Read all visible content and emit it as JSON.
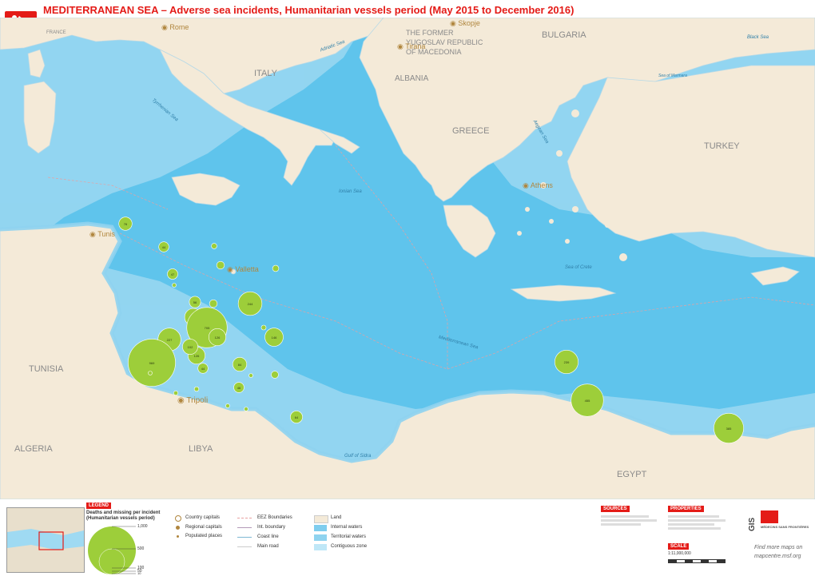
{
  "title": "MEDITERRANEAN SEA – Adverse sea incidents, Humanitarian vessels period (May 2015 to December 2016)",
  "colors": {
    "land": "#f4ead8",
    "territorial": "#8fd3ef",
    "contiguous": "#bfe7f7",
    "internal": "#7fcdee",
    "sea": "#5fc4ec",
    "incident": "#9dce3a",
    "accent": "#e41b17"
  },
  "countries": [
    "FRANCE",
    "ITALY",
    "BULGARIA",
    "THE FORMER",
    "YUGOSLAV REPUBLIC",
    "OF MACEDONIA",
    "ALBANIA",
    "GREECE",
    "TURKEY",
    "TUNISIA",
    "ALGERIA",
    "LIBYA",
    "EGYPT"
  ],
  "capitals": [
    "Rome",
    "Skopje",
    "Tirana",
    "Athens",
    "Tunis",
    "Valletta",
    "Tripoli"
  ],
  "seas": [
    "Black Sea",
    "Adriatic Sea",
    "Tyrrhenian Sea",
    "Ionian Sea",
    "Sea of Crete",
    "Mediterranean Sea",
    "Gulf of Sidra",
    "Aegean Sea",
    "Sea of Marmara"
  ],
  "incidents": [
    {
      "label": "76"
    },
    {
      "label": "44"
    },
    {
      "label": "13"
    },
    {
      "label": "47"
    },
    {
      "label": "4"
    },
    {
      "label": "56"
    },
    {
      "label": "11"
    },
    {
      "label": "26"
    },
    {
      "label": "244"
    },
    {
      "label": "131"
    },
    {
      "label": "705"
    },
    {
      "label": "227"
    },
    {
      "label": "126"
    },
    {
      "label": "126"
    },
    {
      "label": "102"
    },
    {
      "label": "969"
    },
    {
      "label": "44"
    },
    {
      "label": "146"
    },
    {
      "label": "84"
    },
    {
      "label": "46"
    },
    {
      "label": "1"
    },
    {
      "label": "239"
    },
    {
      "label": "455"
    },
    {
      "label": "385"
    },
    {
      "label": "64"
    },
    {
      "label": "7"
    },
    {
      "label": "10"
    },
    {
      "label": "22"
    },
    {
      "label": "4"
    },
    {
      "label": "9"
    },
    {
      "label": "2"
    },
    {
      "label": "8"
    },
    {
      "label": "26"
    },
    {
      "label": "17"
    }
  ],
  "legend": {
    "header": "LEGEND",
    "incident_title": "Deaths and missing per incident",
    "incident_sub": "(Humanitarian vessels period)",
    "size_values": [
      "1,000",
      "500",
      "100",
      "50",
      "10"
    ],
    "items": [
      {
        "label": "Country capitals"
      },
      {
        "label": "Regional capitals"
      },
      {
        "label": "Populated places"
      },
      {
        "label": "EEZ Boundaries"
      },
      {
        "label": "Int. boundary"
      },
      {
        "label": "Coast line"
      },
      {
        "label": "Main road"
      },
      {
        "label": "Land"
      },
      {
        "label": "Internal waters"
      },
      {
        "label": "Territorial waters"
      },
      {
        "label": "Contiguous zone"
      }
    ],
    "sources_header": "SOURCES",
    "properties_header": "PROPERTIES",
    "scale_header": "SCALE",
    "scale_text": "1:11,000,000",
    "find_more": "Find more maps on",
    "website": "mapcentre.msf.org",
    "org_name": "MÉDECINS SANS FRONTIÈRES",
    "gis": "GIS"
  }
}
